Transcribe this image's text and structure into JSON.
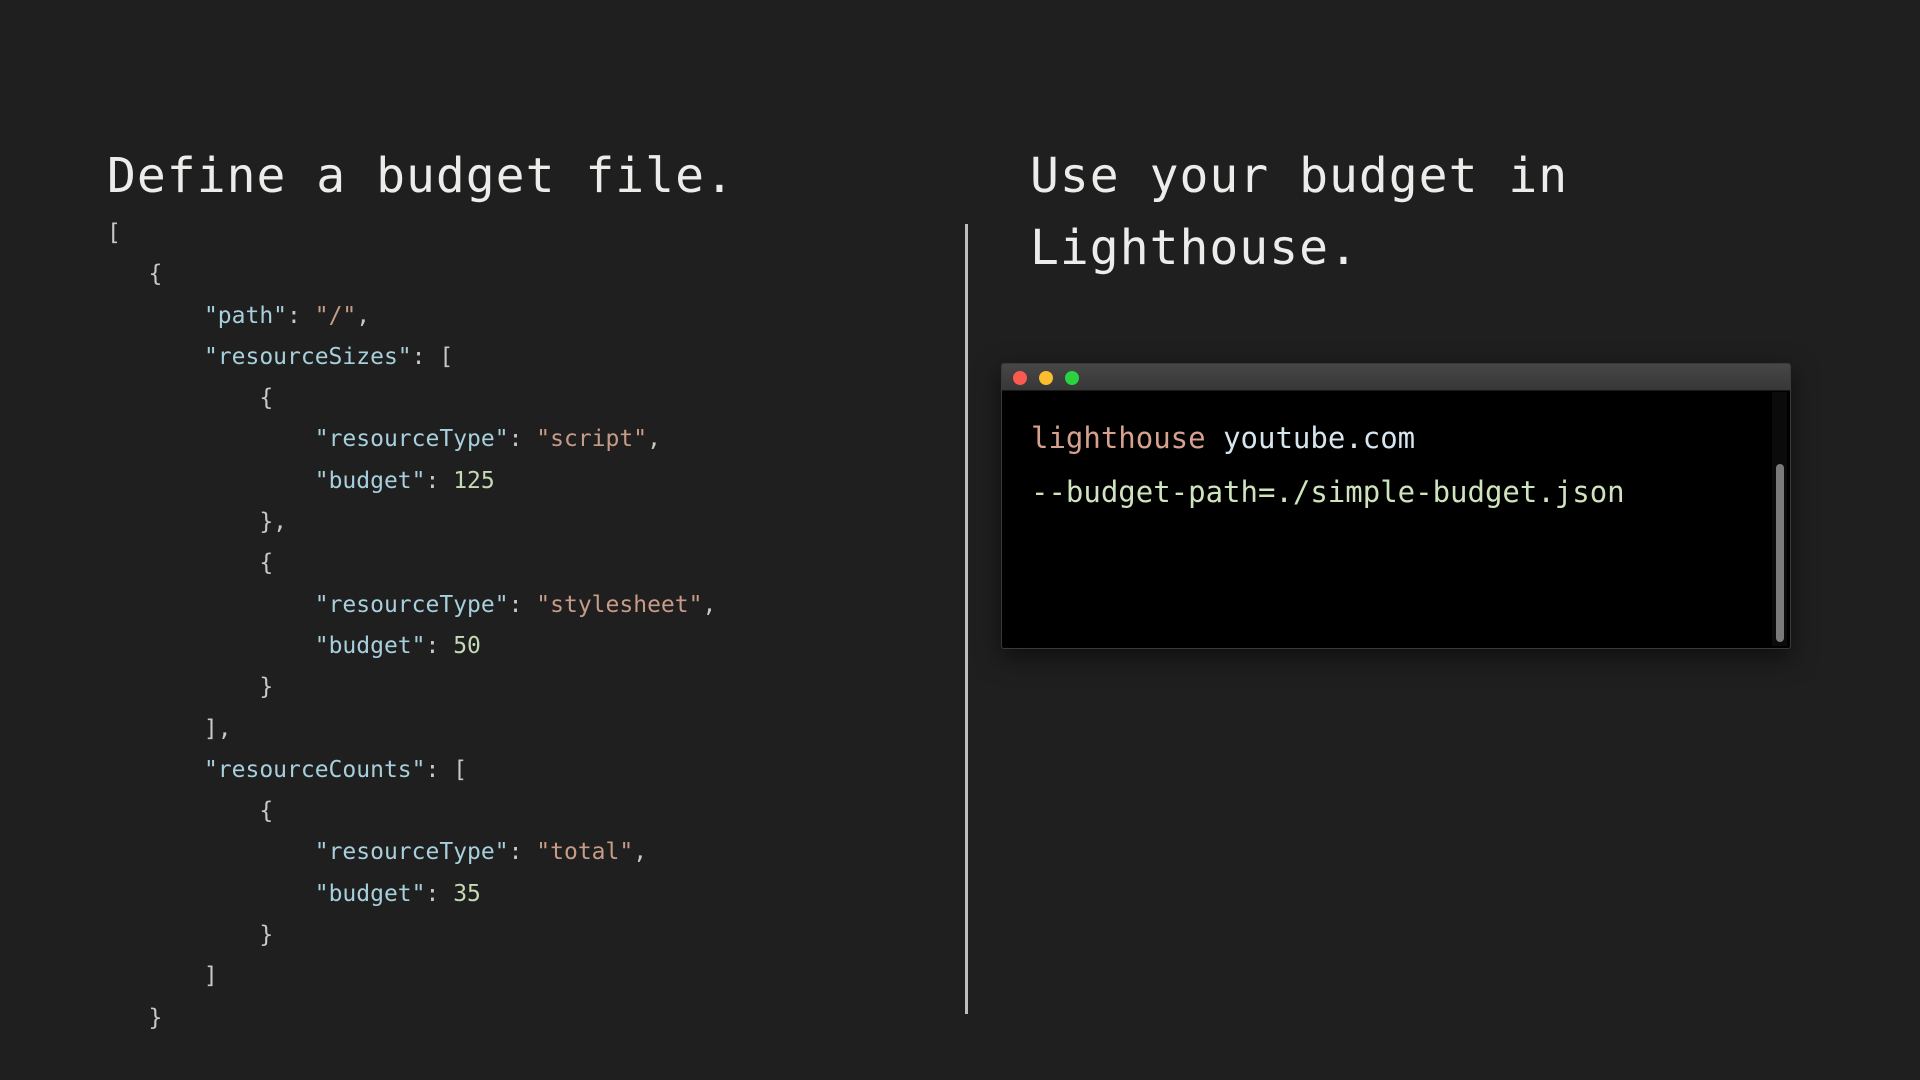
{
  "left": {
    "heading": "Define a budget file.",
    "code": [
      [
        {
          "t": "[",
          "c": "punc"
        }
      ],
      [
        {
          "t": "   {",
          "c": "punc"
        }
      ],
      [
        {
          "t": "       ",
          "c": "punc"
        },
        {
          "t": "\"path\"",
          "c": "key"
        },
        {
          "t": ": ",
          "c": "punc"
        },
        {
          "t": "\"/\"",
          "c": "str"
        },
        {
          "t": ",",
          "c": "punc"
        }
      ],
      [
        {
          "t": "       ",
          "c": "punc"
        },
        {
          "t": "\"resourceSizes\"",
          "c": "key"
        },
        {
          "t": ": [",
          "c": "punc"
        }
      ],
      [
        {
          "t": "           {",
          "c": "punc"
        }
      ],
      [
        {
          "t": "               ",
          "c": "punc"
        },
        {
          "t": "\"resourceType\"",
          "c": "key"
        },
        {
          "t": ": ",
          "c": "punc"
        },
        {
          "t": "\"script\"",
          "c": "str"
        },
        {
          "t": ",",
          "c": "punc"
        }
      ],
      [
        {
          "t": "               ",
          "c": "punc"
        },
        {
          "t": "\"budget\"",
          "c": "key"
        },
        {
          "t": ": ",
          "c": "punc"
        },
        {
          "t": "125",
          "c": "num"
        }
      ],
      [
        {
          "t": "           },",
          "c": "punc"
        }
      ],
      [
        {
          "t": "           {",
          "c": "punc"
        }
      ],
      [
        {
          "t": "               ",
          "c": "punc"
        },
        {
          "t": "\"resourceType\"",
          "c": "key"
        },
        {
          "t": ": ",
          "c": "punc"
        },
        {
          "t": "\"stylesheet\"",
          "c": "str"
        },
        {
          "t": ",",
          "c": "punc"
        }
      ],
      [
        {
          "t": "               ",
          "c": "punc"
        },
        {
          "t": "\"budget\"",
          "c": "key"
        },
        {
          "t": ": ",
          "c": "punc"
        },
        {
          "t": "50",
          "c": "num"
        }
      ],
      [
        {
          "t": "           }",
          "c": "punc"
        }
      ],
      [
        {
          "t": "       ],",
          "c": "punc"
        }
      ],
      [
        {
          "t": "       ",
          "c": "punc"
        },
        {
          "t": "\"resourceCounts\"",
          "c": "key"
        },
        {
          "t": ": [",
          "c": "punc"
        }
      ],
      [
        {
          "t": "           {",
          "c": "punc"
        }
      ],
      [
        {
          "t": "               ",
          "c": "punc"
        },
        {
          "t": "\"resourceType\"",
          "c": "key"
        },
        {
          "t": ": ",
          "c": "punc"
        },
        {
          "t": "\"total\"",
          "c": "str"
        },
        {
          "t": ",",
          "c": "punc"
        }
      ],
      [
        {
          "t": "               ",
          "c": "punc"
        },
        {
          "t": "\"budget\"",
          "c": "key"
        },
        {
          "t": ": ",
          "c": "punc"
        },
        {
          "t": "35",
          "c": "num"
        }
      ],
      [
        {
          "t": "           }",
          "c": "punc"
        }
      ],
      [
        {
          "t": "       ]",
          "c": "punc"
        }
      ],
      [
        {
          "t": "   }",
          "c": "punc"
        }
      ]
    ]
  },
  "right": {
    "heading_line1": "Use your budget in",
    "heading_line2": "Lighthouse.",
    "terminal": {
      "command": "lighthouse",
      "url": "youtube.com",
      "flag": "--budget-path=./simple-budget.json"
    }
  },
  "colors": {
    "background": "#1e1f1e",
    "json_key": "#a7cfdc",
    "json_string": "#c79b87",
    "json_number": "#c5d9b4",
    "terminal_command": "#d6a18e",
    "terminal_flag": "#cfe4bd",
    "window_close": "#fc5a50",
    "window_minimize": "#fcbd2e",
    "window_zoom": "#2bd23f"
  }
}
